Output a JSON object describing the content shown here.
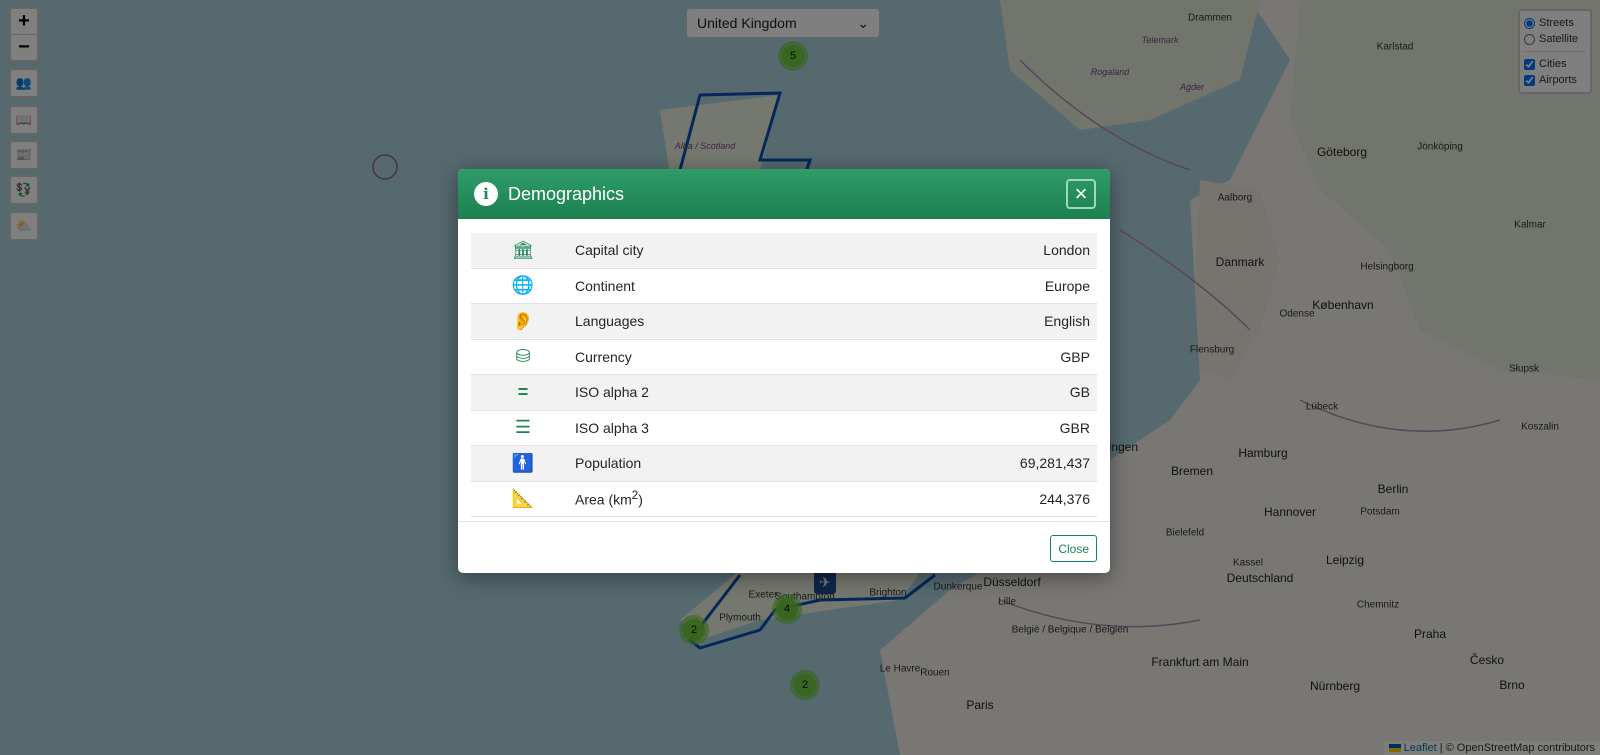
{
  "country_select": {
    "value": "United Kingdom"
  },
  "controls": {
    "zoom_in": "+",
    "zoom_out": "−",
    "buttons": [
      {
        "icon": "people-icon",
        "glyph": "👥"
      },
      {
        "icon": "book-icon",
        "glyph": "📖"
      },
      {
        "icon": "newspaper-icon",
        "glyph": "📰"
      },
      {
        "icon": "currency-exchange-icon",
        "glyph": "💱"
      },
      {
        "icon": "weather-icon",
        "glyph": "⛅"
      }
    ]
  },
  "layers": {
    "base": [
      {
        "label": "Streets",
        "checked": true
      },
      {
        "label": "Satellite",
        "checked": false
      }
    ],
    "overlays": [
      {
        "label": "Cities",
        "checked": true
      },
      {
        "label": "Airports",
        "checked": true
      }
    ]
  },
  "attribution": {
    "leaflet": "Leaflet",
    "rest": " | © OpenStreetMap contributors"
  },
  "map": {
    "clusters": [
      "5",
      "2",
      "4",
      "2"
    ],
    "places": [
      "Drammen",
      "Karlstad",
      "Telemark",
      "Rogaland",
      "Agder",
      "Göteborg",
      "Jönköping",
      "Aalborg",
      "Danmark",
      "København",
      "Helsingborg",
      "Kalmar",
      "Odense",
      "Flensburg",
      "Lübeck",
      "Hamburg",
      "Bremen",
      "Groningen",
      "Hannover",
      "Berlin",
      "Potsdam",
      "Koszalin",
      "Słupsk",
      "Leipzig",
      "Deutschland",
      "Chemnitz",
      "Praha",
      "Brno",
      "Česko",
      "Düsseldorf",
      "Lille",
      "België / Belgique / Belgien",
      "Frankfurt am Main",
      "Nürnberg",
      "Paris",
      "Rouen",
      "Le Havre",
      "Dunkerque",
      "Kassel",
      "Bielefeld",
      "Plymouth",
      "Exeter",
      "Southampton",
      "Brighton",
      "Alba / Scotland"
    ]
  },
  "modal": {
    "title": "Demographics",
    "rows": [
      {
        "icon": "landmark-icon",
        "label": "Capital city",
        "value": "London"
      },
      {
        "icon": "globe-icon",
        "label": "Continent",
        "value": "Europe"
      },
      {
        "icon": "ear-listen-icon",
        "label": "Languages",
        "value": "English"
      },
      {
        "icon": "coins-icon",
        "label": "Currency",
        "value": "GBP"
      },
      {
        "icon": "equals-icon",
        "label": "ISO alpha 2",
        "value": "GB"
      },
      {
        "icon": "bars-icon",
        "label": "ISO alpha 3",
        "value": "GBR"
      },
      {
        "icon": "person-icon",
        "label": "Population",
        "value": "69,281,437"
      },
      {
        "icon": "ruler-icon",
        "label": "Area (km",
        "label_sup": "2",
        "label_end": ")",
        "value": "244,376"
      }
    ],
    "close_label": "Close"
  },
  "colors": {
    "header": "#1e8a56",
    "accent": "#198754",
    "border_blue": "#0b4fb3"
  }
}
